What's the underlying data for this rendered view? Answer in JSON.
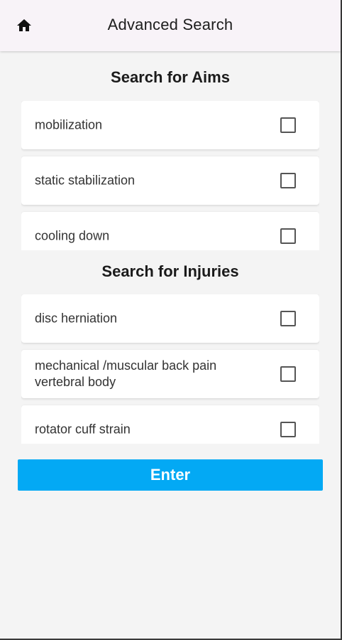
{
  "header": {
    "title": "Advanced Search",
    "home_icon": "home-icon"
  },
  "aims": {
    "title": "Search for Aims",
    "items": [
      {
        "label": "mobilization",
        "checked": false
      },
      {
        "label": "static stabilization",
        "checked": false
      },
      {
        "label": "cooling down",
        "checked": false
      }
    ]
  },
  "injuries": {
    "title": "Search for Injuries",
    "items": [
      {
        "label": "disc herniation",
        "checked": false
      },
      {
        "label": "mechanical /muscular back pain\nvertebral body",
        "checked": false
      },
      {
        "label": "rotator cuff strain",
        "checked": false
      }
    ]
  },
  "actions": {
    "enter_label": "Enter"
  },
  "colors": {
    "primary": "#03a9f4",
    "appbar_bg": "#f8f3f8",
    "page_bg": "#f4f4f4"
  }
}
